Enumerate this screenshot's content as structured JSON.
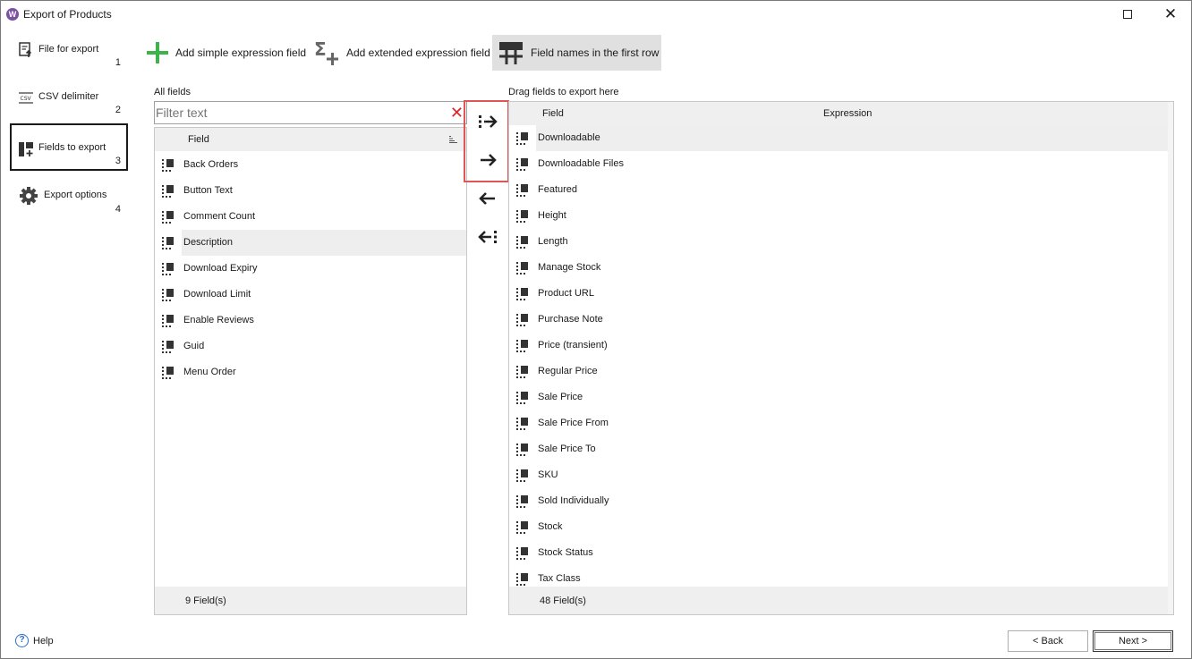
{
  "window": {
    "title": "Export of Products",
    "app_icon": "W"
  },
  "sidebar": {
    "items": [
      {
        "label": "File for export",
        "num": "1",
        "icon": "file-export-icon"
      },
      {
        "label": "CSV delimiter",
        "num": "2",
        "icon": "csv-icon"
      },
      {
        "label": "Fields to export",
        "num": "3",
        "icon": "fields-add-icon",
        "active": true
      },
      {
        "label": "Export options",
        "num": "4",
        "icon": "gear-icon"
      }
    ]
  },
  "toolbar": {
    "add_simple": "Add simple expression field",
    "add_extended": "Add extended expression field",
    "field_names": "Field names in the first row"
  },
  "all_fields": {
    "label": "All fields",
    "filter_placeholder": "Filter text",
    "column": "Field",
    "rows": [
      "Back Orders",
      "Button Text",
      "Comment Count",
      "Description",
      "Download Expiry",
      "Download Limit",
      "Enable Reviews",
      "Guid",
      "Menu Order"
    ],
    "selected_index": 3,
    "count": "9 Field(s)"
  },
  "export_fields": {
    "label": "Drag fields to export here",
    "col_field": "Field",
    "col_expression": "Expression",
    "rows": [
      "Downloadable",
      "Downloadable Files",
      "Featured",
      "Height",
      "Length",
      "Manage Stock",
      "Product URL",
      "Purchase Note",
      "Price (transient)",
      "Regular Price",
      "Sale Price",
      "Sale Price From",
      "Sale Price To",
      "SKU",
      "Sold Individually",
      "Stock",
      "Stock Status",
      "Tax Class"
    ],
    "selected_index": 0,
    "count": "48 Field(s)"
  },
  "footer": {
    "help": "Help",
    "back": "< Back",
    "next": "Next >"
  },
  "colors": {
    "accent_green": "#3cb44b",
    "highlight_red": "#e05555",
    "app_purple": "#7b51a4",
    "help_blue": "#2a6fc9"
  }
}
